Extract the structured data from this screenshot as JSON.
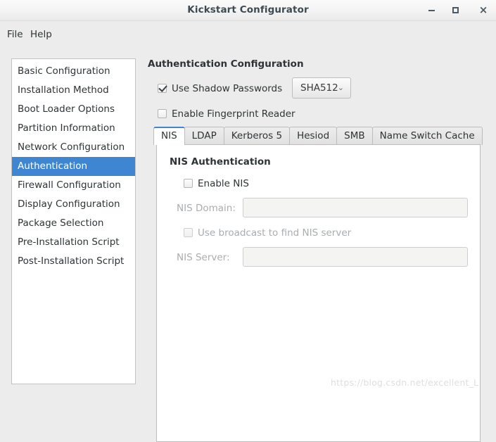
{
  "window": {
    "title": "Kickstart Configurator",
    "controls": {
      "minimize": "minimize-icon",
      "maximize": "maximize-icon",
      "close": "×"
    }
  },
  "menubar": {
    "items": [
      {
        "label": "File"
      },
      {
        "label": "Help"
      }
    ]
  },
  "sidebar": {
    "items": [
      {
        "label": "Basic Configuration",
        "selected": false
      },
      {
        "label": "Installation Method",
        "selected": false
      },
      {
        "label": "Boot Loader Options",
        "selected": false
      },
      {
        "label": "Partition Information",
        "selected": false
      },
      {
        "label": "Network Configuration",
        "selected": false
      },
      {
        "label": "Authentication",
        "selected": true
      },
      {
        "label": "Firewall Configuration",
        "selected": false
      },
      {
        "label": "Display Configuration",
        "selected": false
      },
      {
        "label": "Package Selection",
        "selected": false
      },
      {
        "label": "Pre-Installation Script",
        "selected": false
      },
      {
        "label": "Post-Installation Script",
        "selected": false
      }
    ],
    "selected_color": "#3f86d2"
  },
  "main": {
    "title": "Authentication Configuration",
    "shadow_passwords": {
      "label": "Use Shadow Passwords",
      "checked": true
    },
    "hash_algorithm": {
      "selected": "SHA512",
      "arrow": "⌄",
      "options": [
        "SHA512"
      ]
    },
    "fingerprint_reader": {
      "label": "Enable Fingerprint Reader",
      "checked": false
    },
    "tabs": [
      {
        "label": "NIS",
        "active": true
      },
      {
        "label": "LDAP",
        "active": false
      },
      {
        "label": "Kerberos 5",
        "active": false
      },
      {
        "label": "Hesiod",
        "active": false
      },
      {
        "label": "SMB",
        "active": false
      },
      {
        "label": "Name Switch Cache",
        "active": false
      }
    ],
    "nis_panel": {
      "heading": "NIS Authentication",
      "enable_nis": {
        "label": "Enable NIS",
        "checked": false
      },
      "domain": {
        "label": "NIS Domain:",
        "value": "",
        "disabled": true
      },
      "broadcast": {
        "label": "Use broadcast to find NIS server",
        "checked": false,
        "disabled": true
      },
      "server": {
        "label": "NIS Server:",
        "value": "",
        "disabled": true
      }
    }
  },
  "watermark": {
    "text": "https://blog.csdn.net/excellent_L"
  }
}
